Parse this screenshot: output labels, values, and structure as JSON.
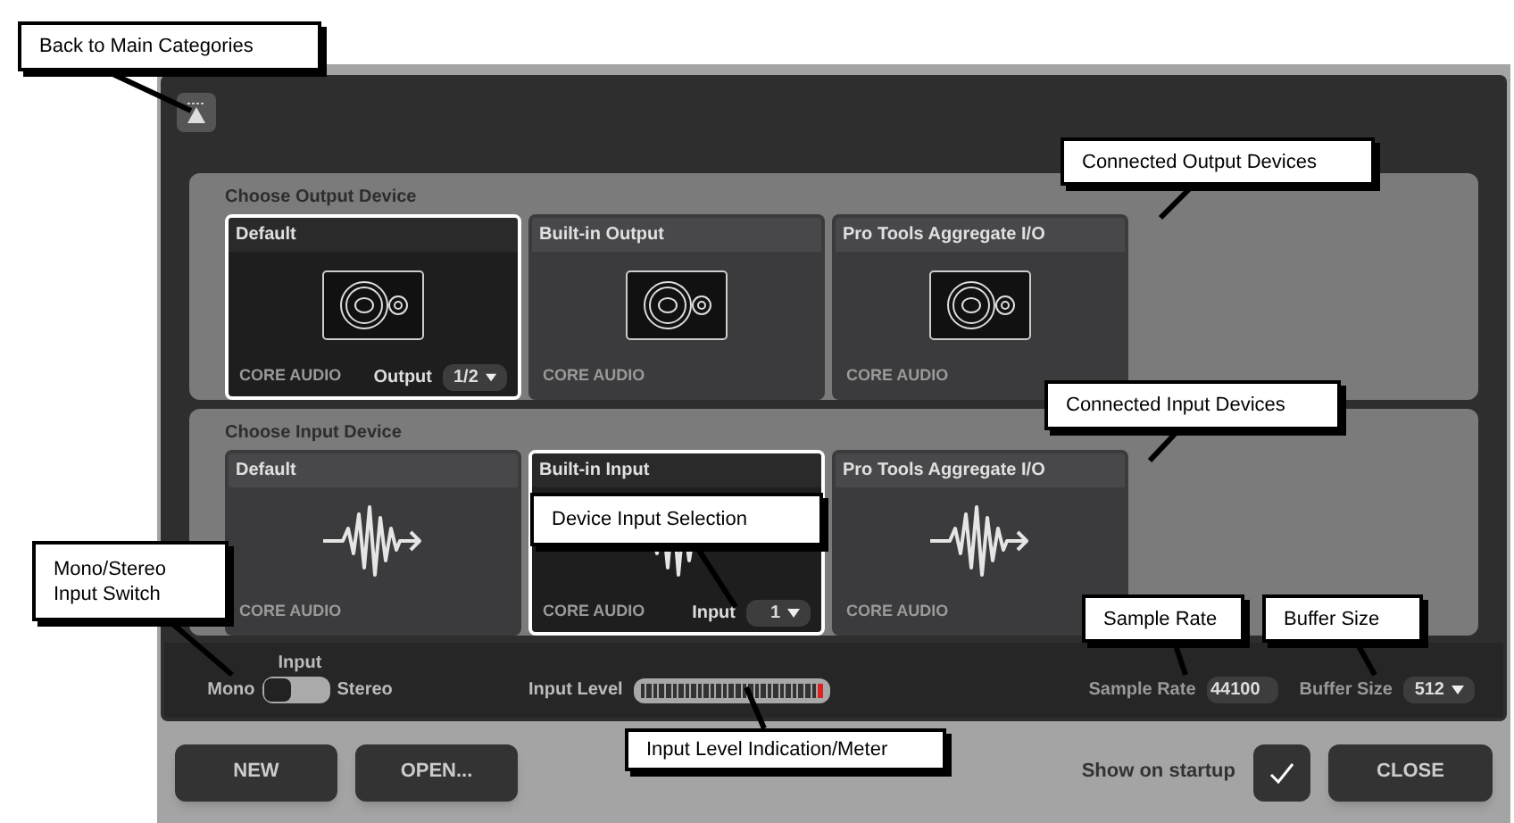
{
  "back_button": {
    "kind": "categories"
  },
  "output_section": {
    "title": "Choose Output Device",
    "devices": [
      {
        "name": "Default",
        "driver": "CORE AUDIO",
        "selected": true,
        "channel_label": "Output",
        "channel_value": "1/2"
      },
      {
        "name": "Built-in Output",
        "driver": "CORE AUDIO",
        "selected": false
      },
      {
        "name": "Pro Tools Aggregate I/O",
        "driver": "CORE AUDIO",
        "selected": false
      }
    ]
  },
  "input_section": {
    "title": "Choose Input Device",
    "devices": [
      {
        "name": "Default",
        "driver": "CORE AUDIO",
        "selected": false
      },
      {
        "name": "Built-in Input",
        "driver": "CORE AUDIO",
        "selected": true,
        "channel_label": "Input",
        "channel_value": "1"
      },
      {
        "name": "Pro Tools Aggregate I/O",
        "driver": "CORE AUDIO",
        "selected": false
      }
    ]
  },
  "input_mode": {
    "title": "Input",
    "left_label": "Mono",
    "right_label": "Stereo",
    "stereo": false
  },
  "input_level": {
    "label": "Input Level"
  },
  "sample_rate": {
    "label": "Sample Rate",
    "value": "44100"
  },
  "buffer_size": {
    "label": "Buffer Size",
    "value": "512"
  },
  "buttons": [
    {
      "label": "NEW"
    },
    {
      "label": "OPEN..."
    }
  ],
  "show_on_startup": {
    "label": "Show on startup",
    "checked": true
  },
  "close_button": {
    "label": "CLOSE"
  },
  "callouts": [
    {
      "text": "Back to Main Categories"
    },
    {
      "text": "Connected Output Devices"
    },
    {
      "text": "Connected Input Devices"
    },
    {
      "text": "Device Input Selection"
    },
    {
      "text": "Mono/Stereo Input Switch"
    },
    {
      "text": "Input Level Indication/Meter"
    },
    {
      "text": "Sample Rate"
    },
    {
      "text": "Buffer Size"
    }
  ]
}
